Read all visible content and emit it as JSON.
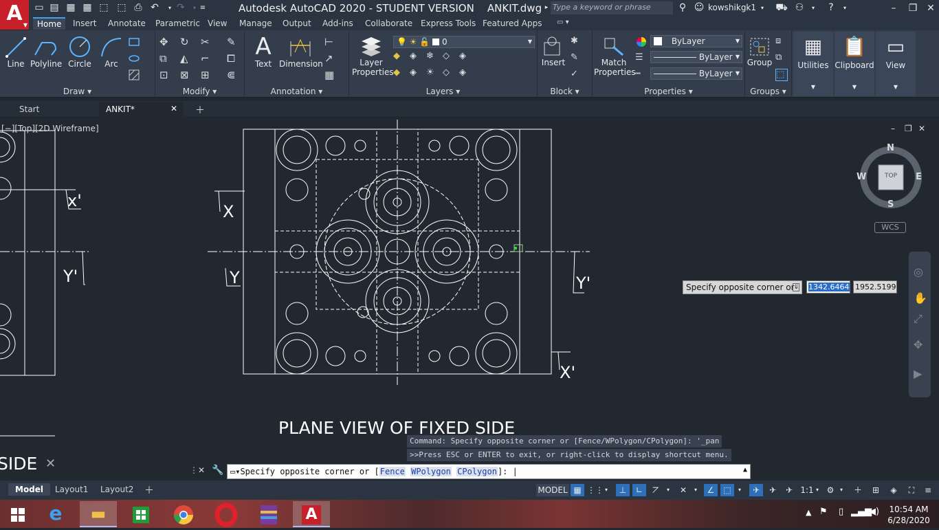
{
  "window": {
    "title": "Autodesk AutoCAD 2020 - STUDENT VERSION    ANKIT.dwg",
    "search_placeholder": "Type a keyword or phrase",
    "user": "kowshikgk1",
    "app_logo": "A"
  },
  "ribbon_tabs": [
    "Home",
    "Insert",
    "Annotate",
    "Parametric",
    "View",
    "Manage",
    "Output",
    "Add-ins",
    "Collaborate",
    "Express Tools",
    "Featured Apps"
  ],
  "ribbon": {
    "draw": {
      "title": "Draw",
      "tools": [
        "Line",
        "Polyline",
        "Circle",
        "Arc"
      ]
    },
    "modify": {
      "title": "Modify"
    },
    "annotation": {
      "title": "Annotation",
      "tools": [
        "Text",
        "Dimension"
      ]
    },
    "layers": {
      "title": "Layers",
      "layer_props_1": "Layer",
      "layer_props_2": "Properties",
      "current_layer": "0"
    },
    "block": {
      "title": "Block",
      "insert": "Insert"
    },
    "properties": {
      "title": "Properties",
      "match_1": "Match",
      "match_2": "Properties",
      "color": "ByLayer",
      "linetype": "ByLayer",
      "lineweight": "ByLayer"
    },
    "groups": {
      "title": "Groups",
      "group": "Group"
    },
    "utilities": "Utilities",
    "clipboard": "Clipboard",
    "view": "View"
  },
  "doc_tabs": {
    "start": "Start",
    "active": "ANKIT*"
  },
  "viewport_label": "[−][Top][2D Wireframe]",
  "viewcube": {
    "n": "N",
    "s": "S",
    "e": "E",
    "w": "W",
    "top": "TOP",
    "wcs": "WCS"
  },
  "drawing": {
    "title": "PLANE VIEW OF FIXED SIDE",
    "side_label": "SIDE",
    "label_x": "X",
    "label_x_prime": "X'",
    "label_y": "Y",
    "label_y_prime": "Y'",
    "left_x_prime": "x'",
    "left_y_prime": "Y'"
  },
  "dynamic_input": {
    "prompt": "Specify opposite corner or",
    "value1": "1342.6464",
    "value2": "1952.5199"
  },
  "command": {
    "history_1": "Command: Specify opposite corner or [Fence/WPolygon/CPolygon]: '_pan",
    "history_2": ">>Press ESC or ENTER to exit, or right-click to display shortcut menu.",
    "prompt": "Specify opposite corner or [",
    "opt1": "Fence",
    "opt2": "WPolygon",
    "opt3": "CPolygon",
    "suffix": "]: "
  },
  "layout_tabs": [
    "Model",
    "Layout1",
    "Layout2"
  ],
  "status": {
    "model": "MODEL",
    "scale": "1:1"
  },
  "clock": {
    "time": "10:54 AM",
    "date": "6/28/2020"
  },
  "colors": {
    "accent": "#4a9fe0",
    "logo_red": "#c8202a",
    "canvas": "#212830"
  }
}
